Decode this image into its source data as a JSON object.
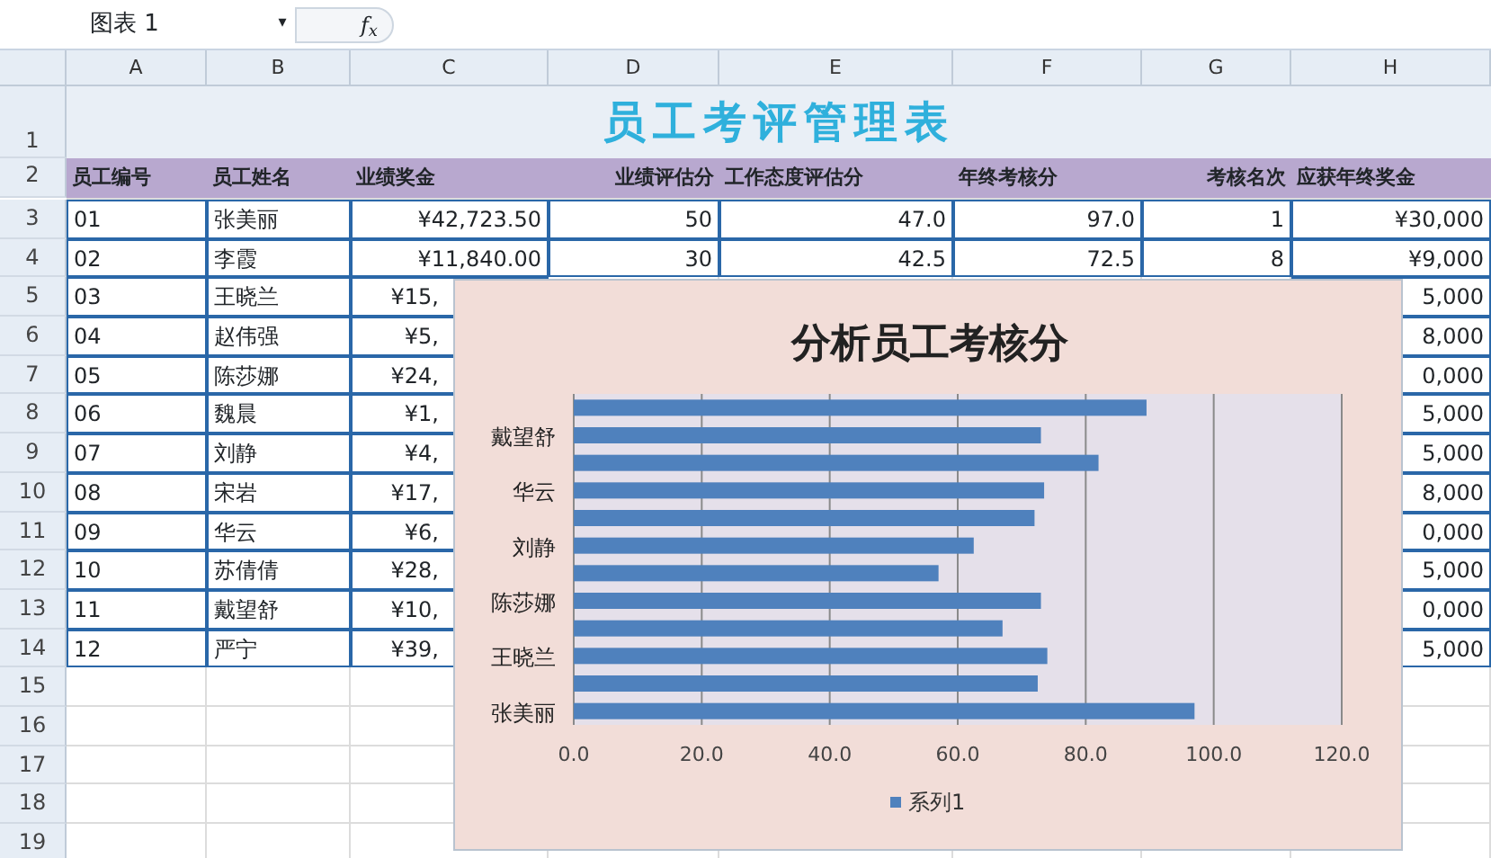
{
  "formula_bar": {
    "name_box": "图表 1",
    "dropdown": "▾",
    "fx": "f$_{x}$"
  },
  "columns": [
    "A",
    "B",
    "C",
    "D",
    "E",
    "F",
    "G",
    "H"
  ],
  "title_row": {
    "number": "1",
    "title": "员工考评管理表"
  },
  "header_row": {
    "number": "2",
    "cells": [
      "员工编号",
      "员工姓名",
      "业绩奖金",
      "业绩评估分",
      "工作态度评估分",
      "年终考核分",
      "考核名次",
      "应获年终奖金"
    ]
  },
  "rows": [
    {
      "number": "3",
      "kind": "full",
      "cells": [
        "01",
        "张美丽",
        "¥42,723.50",
        "50",
        "47.0",
        "97.0",
        "1",
        "¥30,000"
      ]
    },
    {
      "number": "4",
      "kind": "full",
      "cells": [
        "02",
        "李霞",
        "¥11,840.00",
        "30",
        "42.5",
        "72.5",
        "8",
        "¥9,000"
      ]
    },
    {
      "number": "5",
      "kind": "partial",
      "cells": [
        "03",
        "王晓兰",
        "¥15,",
        "5,000"
      ]
    },
    {
      "number": "6",
      "kind": "partial",
      "cells": [
        "04",
        "赵伟强",
        "¥5,",
        "8,000"
      ]
    },
    {
      "number": "7",
      "kind": "partial",
      "cells": [
        "05",
        "陈莎娜",
        "¥24,",
        "0,000"
      ]
    },
    {
      "number": "8",
      "kind": "partial",
      "cells": [
        "06",
        "魏晨",
        "¥1,",
        "5,000"
      ]
    },
    {
      "number": "9",
      "kind": "partial",
      "cells": [
        "07",
        "刘静",
        "¥4,",
        "5,000"
      ]
    },
    {
      "number": "10",
      "kind": "partial",
      "cells": [
        "08",
        "宋岩",
        "¥17,",
        "8,000"
      ]
    },
    {
      "number": "11",
      "kind": "partial",
      "cells": [
        "09",
        "华云",
        "¥6,",
        "0,000"
      ]
    },
    {
      "number": "12",
      "kind": "partial",
      "cells": [
        "10",
        "苏倩倩",
        "¥28,",
        "5,000"
      ]
    },
    {
      "number": "13",
      "kind": "partial",
      "cells": [
        "11",
        "戴望舒",
        "¥10,",
        "0,000"
      ]
    },
    {
      "number": "14",
      "kind": "partial",
      "cells": [
        "12",
        "严宁",
        "¥39,",
        "5,000"
      ]
    }
  ],
  "empty_rows": [
    "15",
    "16",
    "17",
    "18",
    "19"
  ],
  "chart": {
    "chart_data": {
      "type": "bar",
      "orientation": "horizontal",
      "title": "分析员工考核分",
      "categories": [
        null,
        "戴望舒",
        null,
        "华云",
        null,
        "刘静",
        null,
        "陈莎娜",
        null,
        "王晓兰",
        null,
        "张美丽"
      ],
      "series": [
        {
          "name": "系列1",
          "color": "#4f81bd",
          "values": [
            89.5,
            73,
            82,
            73.5,
            72,
            62.5,
            57,
            73,
            67,
            74,
            72.5,
            97
          ]
        }
      ],
      "xlim": [
        0,
        120
      ],
      "grid": true,
      "xticks": [
        {
          "value": 0,
          "label": "0.0"
        },
        {
          "value": 20,
          "label": "20.0"
        },
        {
          "value": 40,
          "label": "40.0"
        },
        {
          "value": 60,
          "label": "60.0"
        },
        {
          "value": 80,
          "label": "80.0"
        },
        {
          "value": 100,
          "label": "100.0"
        },
        {
          "value": 120,
          "label": "120.0"
        }
      ]
    }
  }
}
